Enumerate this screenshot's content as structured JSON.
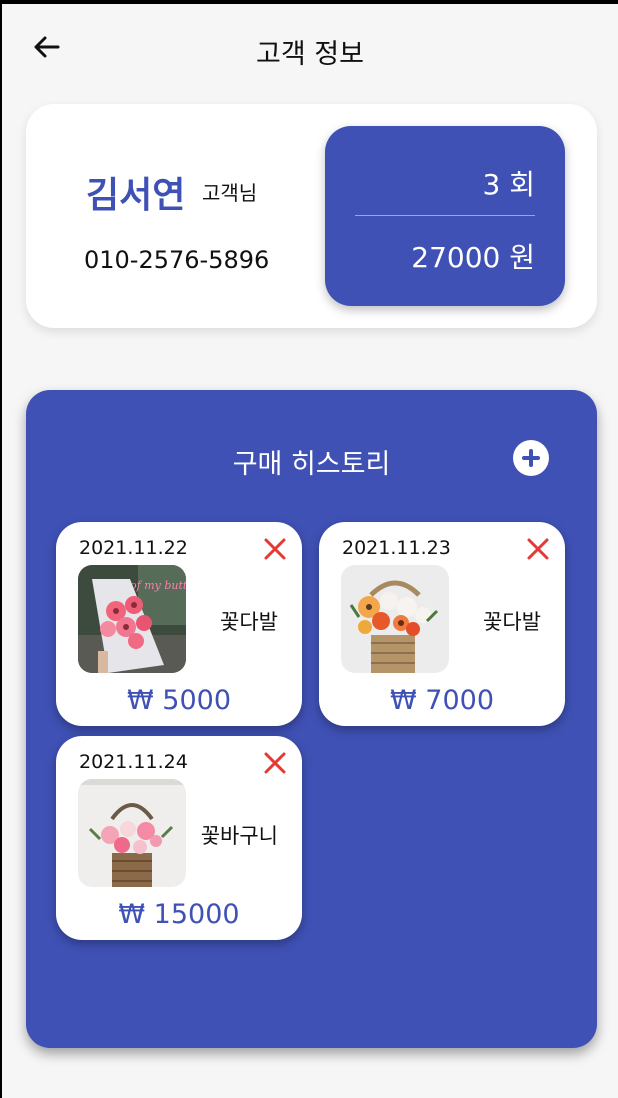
{
  "header": {
    "title": "고객 정보"
  },
  "customer": {
    "name": "김서연",
    "suffix": "고객님",
    "phone": "010-2576-5896",
    "visit_count": "3 회",
    "total_amount": "27000 원"
  },
  "history": {
    "title": "구매 히스토리",
    "items": [
      {
        "date": "2021.11.22",
        "name": "꽃다발",
        "price": "₩ 5000",
        "image": "bouquet-pink-gerbera-image",
        "image_text": "of my butter"
      },
      {
        "date": "2021.11.23",
        "name": "꽃다발",
        "price": "₩ 7000",
        "image": "flower-basket-orange-image"
      },
      {
        "date": "2021.11.24",
        "name": "꽃바구니",
        "price": "₩ 15000",
        "image": "flower-basket-pink-image"
      }
    ]
  },
  "colors": {
    "primary": "#3f51b5",
    "delete": "#e53935",
    "background": "#f6f6f6"
  }
}
